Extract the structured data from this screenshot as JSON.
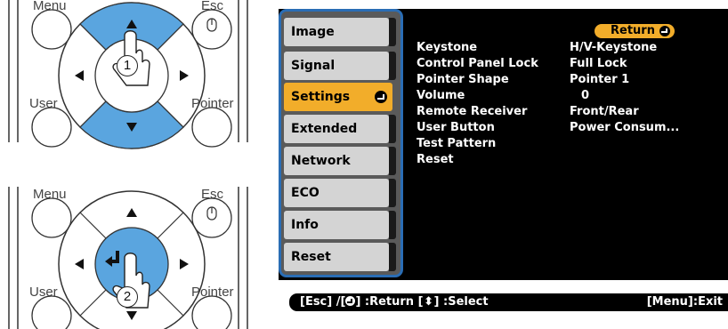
{
  "remote": {
    "top_panel": {
      "menu_label": "Menu",
      "esc_label": "Esc",
      "user_label": "User",
      "pointer_label": "Pointer",
      "step": "1",
      "highlighted_keys": [
        "up-arrow",
        "down-arrow"
      ]
    },
    "bottom_panel": {
      "menu_label": "Menu",
      "esc_label": "Esc",
      "user_label": "User",
      "pointer_label": "Pointer",
      "step": "2",
      "highlighted_keys": [
        "enter"
      ]
    }
  },
  "menu": {
    "tabs": [
      {
        "label": "Image",
        "selected": false
      },
      {
        "label": "Signal",
        "selected": false
      },
      {
        "label": "Settings",
        "selected": true
      },
      {
        "label": "Extended",
        "selected": false
      },
      {
        "label": "Network",
        "selected": false
      },
      {
        "label": "ECO",
        "selected": false
      },
      {
        "label": "Info",
        "selected": false
      },
      {
        "label": "Reset",
        "selected": false
      }
    ],
    "return_label": "Return",
    "rows": [
      {
        "label": "Keystone",
        "value": "H/V-Keystone",
        "has_edge": true
      },
      {
        "label": "Control Panel Lock",
        "value": "Full Lock",
        "has_edge": true
      },
      {
        "label": "Pointer Shape",
        "value": "Pointer 1",
        "has_edge": true
      },
      {
        "label": "Volume",
        "value": "0",
        "has_edge": true
      },
      {
        "label": "Remote Receiver",
        "value": "Front/Rear",
        "has_edge": true
      },
      {
        "label": "User Button",
        "value": "Power Consum...",
        "has_edge": true
      },
      {
        "label": "Test Pattern",
        "value": "",
        "has_edge": true
      },
      {
        "label": "Reset",
        "value": "",
        "has_edge": true
      }
    ]
  },
  "status_bar": {
    "esc_part": "[Esc] /[",
    "return_part": "] :Return  [",
    "select_part": "] :Select",
    "right": "[Menu]:Exit"
  },
  "colors": {
    "highlight_blue": "#5aa5df",
    "selected_orange": "#f2ad2a",
    "frame_blue": "#2a6db5"
  }
}
